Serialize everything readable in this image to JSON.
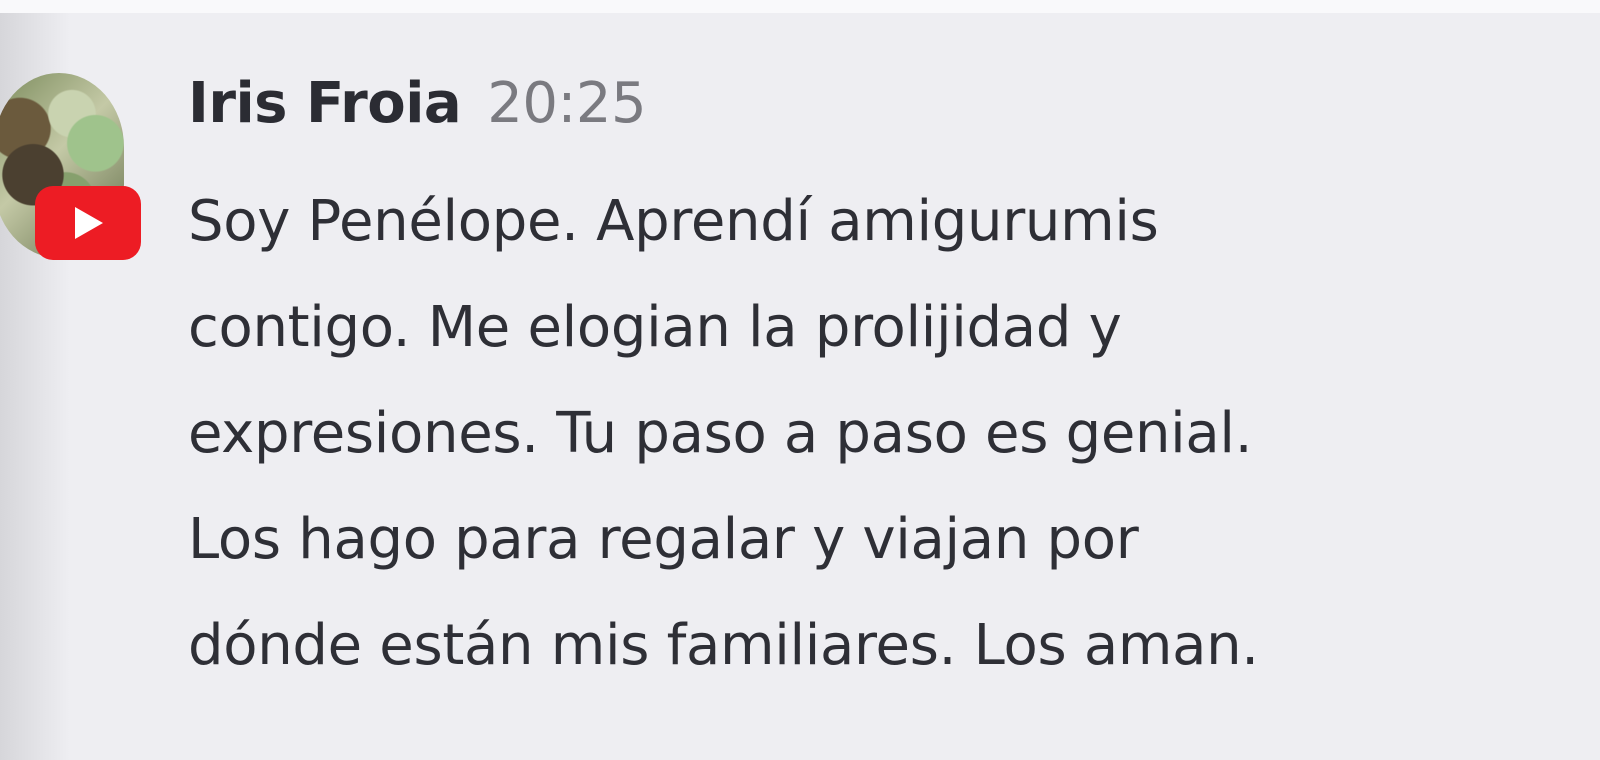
{
  "message": {
    "author": "Iris Froia",
    "time": "20:25",
    "lines": [
      "Soy Penélope. Aprendí amigurumis",
      "contigo. Me elogian la prolijidad y",
      "expresiones. Tu paso a paso es genial.",
      "Los hago para regalar y viajan por",
      "dónde están mis familiares. Los aman."
    ]
  },
  "avatar": {
    "badge_icon": "youtube-play-icon",
    "badge_color": "#ed1c24"
  }
}
